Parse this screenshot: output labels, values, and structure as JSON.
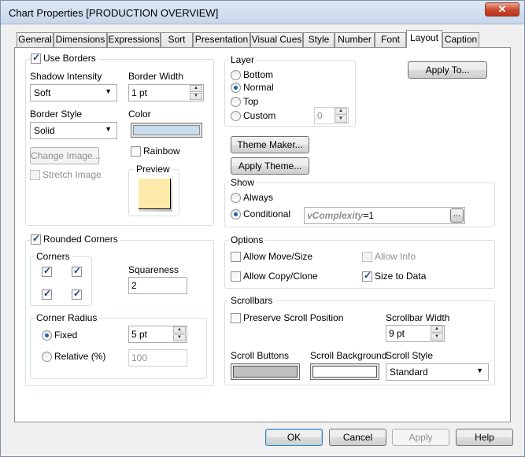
{
  "window": {
    "title": "Chart Properties [PRODUCTION OVERVIEW]",
    "close_glyph": "✕"
  },
  "tabs": [
    "General",
    "Dimensions",
    "Expressions",
    "Sort",
    "Presentation",
    "Visual Cues",
    "Style",
    "Number",
    "Font",
    "Layout",
    "Caption"
  ],
  "active_tab": "Layout",
  "borders": {
    "use_borders_label": "Use Borders",
    "use_borders_checked": true,
    "shadow_intensity_label": "Shadow Intensity",
    "shadow_intensity_value": "Soft",
    "border_width_label": "Border Width",
    "border_width_value": "1 pt",
    "border_style_label": "Border Style",
    "border_style_value": "Solid",
    "color_label": "Color",
    "color_value": "#c9dcf0",
    "change_image_label": "Change Image...",
    "rainbow_label": "Rainbow",
    "stretch_image_label": "Stretch Image",
    "preview_label": "Preview"
  },
  "layer": {
    "label": "Layer",
    "options": [
      "Bottom",
      "Normal",
      "Top",
      "Custom"
    ],
    "selected": "Normal",
    "custom_value": "0"
  },
  "apply_to_label": "Apply To...",
  "theme_maker_label": "Theme Maker...",
  "apply_theme_label": "Apply Theme...",
  "show": {
    "label": "Show",
    "always_label": "Always",
    "conditional_label": "Conditional",
    "selected": "Conditional",
    "expr_name": "vComplexity",
    "expr_rest": "=1",
    "browse_label": "..."
  },
  "rounded": {
    "label": "Rounded Corners",
    "checked": true,
    "corners_label": "Corners",
    "squareness_label": "Squareness",
    "squareness_value": "2",
    "corner_radius_label": "Corner Radius",
    "fixed_label": "Fixed",
    "fixed_value": "5 pt",
    "relative_label": "Relative (%)",
    "relative_value": "100"
  },
  "options": {
    "label": "Options",
    "allow_move_label": "Allow Move/Size",
    "allow_copy_label": "Allow Copy/Clone",
    "allow_info_label": "Allow Info",
    "size_to_data_label": "Size to Data",
    "size_to_data_checked": true
  },
  "scrollbars": {
    "label": "Scrollbars",
    "preserve_label": "Preserve Scroll Position",
    "scrollbar_width_label": "Scrollbar Width",
    "scrollbar_width_value": "9 pt",
    "scroll_buttons_label": "Scroll Buttons",
    "scroll_buttons_color": "#c0c0c0",
    "scroll_background_label": "Scroll Background",
    "scroll_background_color": "#ffffff",
    "scroll_style_label": "Scroll Style",
    "scroll_style_value": "Standard"
  },
  "footer": {
    "ok": "OK",
    "cancel": "Cancel",
    "apply": "Apply",
    "help": "Help"
  }
}
